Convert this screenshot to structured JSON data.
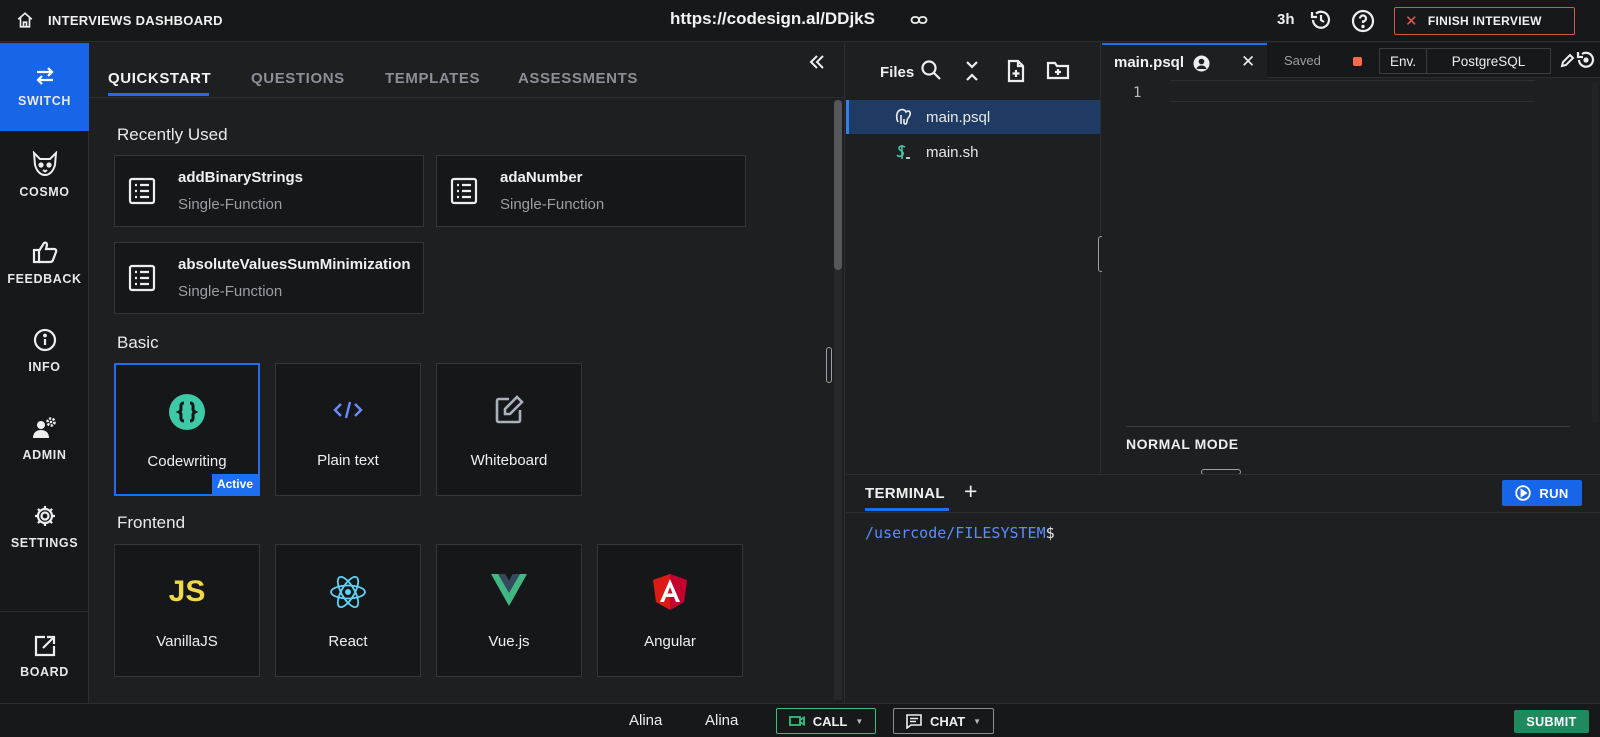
{
  "topbar": {
    "title": "INTERVIEWS DASHBOARD",
    "url": "https://codesign.al/DDjkS",
    "time_left": "3h",
    "finish_label": "FINISH INTERVIEW"
  },
  "rail": {
    "items": [
      {
        "label": "SWITCH",
        "icon": "switch-arrows-icon",
        "active": true
      },
      {
        "label": "COSMO",
        "icon": "cosmo-fox-icon"
      },
      {
        "label": "FEEDBACK",
        "icon": "thumbs-up-icon"
      },
      {
        "label": "INFO",
        "icon": "info-icon"
      },
      {
        "label": "ADMIN",
        "icon": "admin-user-gear-icon"
      },
      {
        "label": "SETTINGS",
        "icon": "gear-icon"
      }
    ],
    "bottom": {
      "label": "BOARD",
      "icon": "external-board-icon"
    }
  },
  "quickstart": {
    "tabs": [
      "QUICKSTART",
      "QUESTIONS",
      "TEMPLATES",
      "ASSESSMENTS"
    ],
    "active_tab": "QUICKSTART",
    "recent_title": "Recently Used",
    "recent": [
      {
        "name": "addBinaryStrings",
        "type": "Single-Function"
      },
      {
        "name": "adaNumber",
        "type": "Single-Function"
      },
      {
        "name": "absoluteValuesSumMinimization",
        "type": "Single-Function"
      }
    ],
    "basic_title": "Basic",
    "basic": [
      {
        "label": "Codewriting",
        "icon": "codewriting-braces-icon",
        "active": true,
        "badge": "Active"
      },
      {
        "label": "Plain text",
        "icon": "code-brackets-icon"
      },
      {
        "label": "Whiteboard",
        "icon": "whiteboard-edit-icon"
      }
    ],
    "frontend_title": "Frontend",
    "frontend": [
      {
        "label": "VanillaJS",
        "icon": "js-logo-icon",
        "glyph": "JS"
      },
      {
        "label": "React",
        "icon": "react-logo-icon"
      },
      {
        "label": "Vue.js",
        "icon": "vue-logo-icon"
      },
      {
        "label": "Angular",
        "icon": "angular-logo-icon"
      }
    ]
  },
  "files": {
    "title": "Files",
    "items": [
      {
        "name": "main.psql",
        "icon": "postgres-elephant-icon",
        "selected": true
      },
      {
        "name": "main.sh",
        "icon": "shell-script-icon"
      }
    ]
  },
  "editor": {
    "tab_name": "main.psql",
    "status": "Saved",
    "env_label": "Env.",
    "env_value": "PostgreSQL",
    "line_number": "1",
    "mode": "NORMAL MODE"
  },
  "terminal": {
    "tab_label": "TERMINAL",
    "add_label": "+",
    "run_label": "RUN",
    "prompt_path": "/usercode/FILESYSTEM",
    "prompt_symbol": "$"
  },
  "bottombar": {
    "users": [
      "Alina",
      "Alina"
    ],
    "call_label": "CALL",
    "chat_label": "CHAT",
    "submit_label": "SUBMIT"
  },
  "colors": {
    "accent": "#1e6ff0",
    "finish_border": "#d9534f",
    "call_border": "#2ec27e",
    "submit_bg": "#1e8a5e",
    "record_dot": "#ff6b4a"
  }
}
